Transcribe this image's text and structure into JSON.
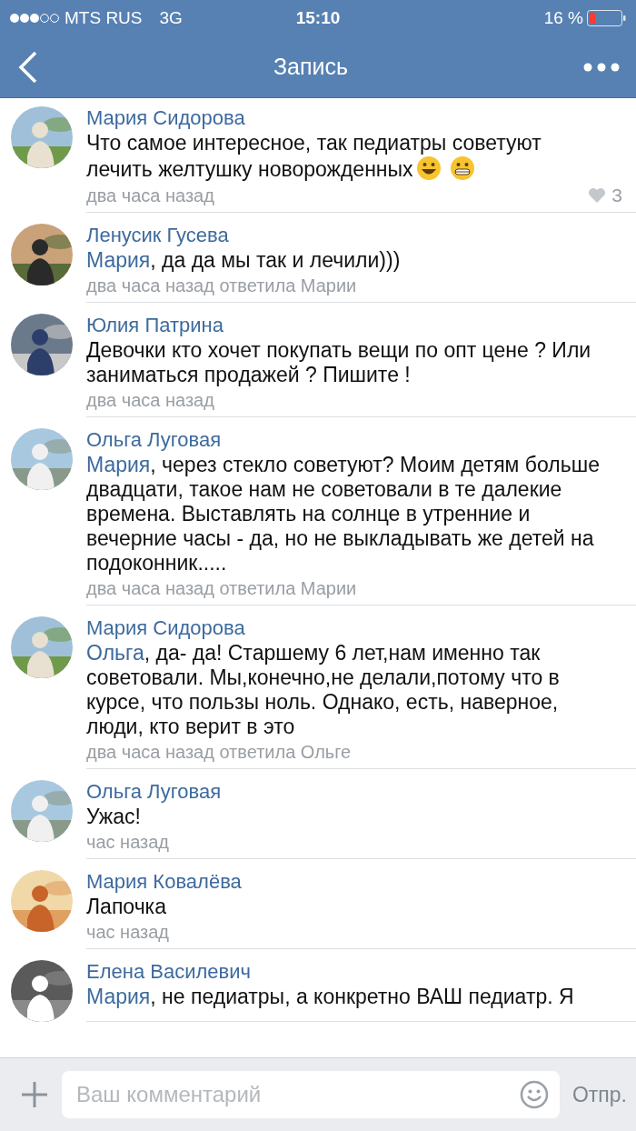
{
  "status_bar": {
    "carrier": "MTS RUS",
    "network": "3G",
    "time": "15:10",
    "battery": "16 %"
  },
  "nav": {
    "title": "Запись"
  },
  "comments": [
    {
      "author": "Мария Сидорова",
      "text": "Что самое интересное, так педиатры советуют лечить желтушку новорожденных",
      "trailing_emojis": true,
      "meta": "два часа назад",
      "likes": "3"
    },
    {
      "author": "Ленусик Гусева",
      "reply_to": "Мария",
      "text": ", да да мы так и лечили)))",
      "meta": "два часа назад ответила Марии"
    },
    {
      "author": "Юлия Патрина",
      "text": "Девочки кто хочет покупать вещи по опт цене ? Или заниматься продажей ? Пишите !",
      "meta": "два часа назад"
    },
    {
      "author": "Ольга Луговая",
      "reply_to": "Мария",
      "text": ", через стекло советуют? Моим детям больше двадцати, такое нам не советовали в те далекие времена. Выставлять на солнце в утренние и вечерние часы - да, но не выкладывать же детей на подоконник.....",
      "meta": "два часа назад ответила Марии"
    },
    {
      "author": "Мария Сидорова",
      "reply_to": "Ольга",
      "text": ", да- да! Старшему 6 лет,нам именно так советовали. Мы,конечно,не делали,потому что в курсе, что пользы ноль. Однако, есть, наверное, люди, кто верит в это",
      "meta": "два часа назад ответила Ольге"
    },
    {
      "author": "Ольга Луговая",
      "text": "Ужас!",
      "meta": "час назад"
    },
    {
      "author": "Мария Ковалёва",
      "text": "Лапочка",
      "meta": "час назад"
    },
    {
      "author": "Елена Василевич",
      "reply_to": "Мария",
      "text": ", не педиатры, а конкретно ВАШ педиатр. Я"
    }
  ],
  "composer": {
    "placeholder": "Ваш комментарий",
    "send": "Отпр."
  }
}
